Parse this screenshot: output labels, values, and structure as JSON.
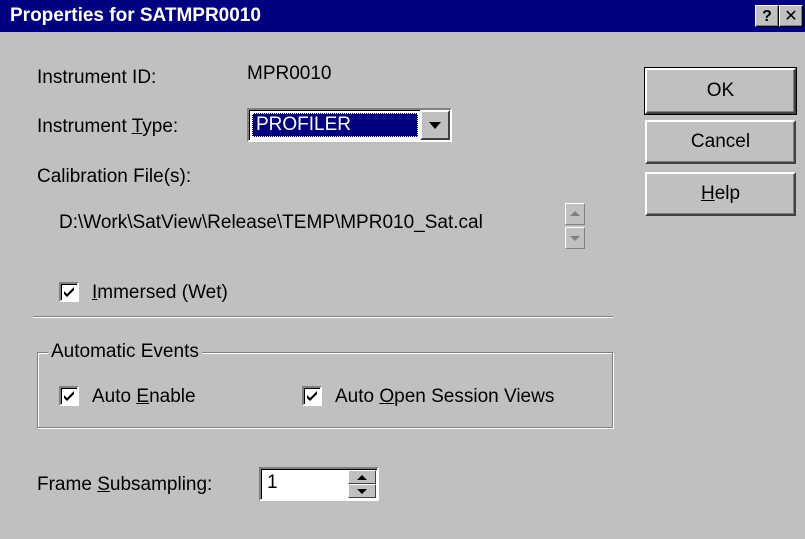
{
  "window": {
    "title": "Properties for SATMPR0010",
    "help_button": "?",
    "close_button": "✕"
  },
  "instrument_id": {
    "label": "Instrument ID:",
    "value": "MPR0010"
  },
  "instrument_type": {
    "label_pre": "Instrument ",
    "label_key": "T",
    "label_post": "ype:",
    "selected": "PROFILER"
  },
  "calibration": {
    "label": "Calibration File(s):",
    "path": "D:\\Work\\SatView\\Release\\TEMP\\MPR010_Sat.cal"
  },
  "immersed": {
    "key": "I",
    "label_post": "mmersed (Wet)",
    "checked": true
  },
  "auto_events": {
    "title": "Automatic Events",
    "auto_enable": {
      "pre": "Auto ",
      "key": "E",
      "post": "nable",
      "checked": true
    },
    "auto_open": {
      "pre": "Auto ",
      "key": "O",
      "post": "pen Session Views",
      "checked": true
    }
  },
  "frame_subsampling": {
    "label_pre": "Frame ",
    "label_key": "S",
    "label_post": "ubsampling:",
    "value": "1"
  },
  "buttons": {
    "ok": "OK",
    "cancel": "Cancel",
    "help_key": "H",
    "help_post": "elp"
  }
}
